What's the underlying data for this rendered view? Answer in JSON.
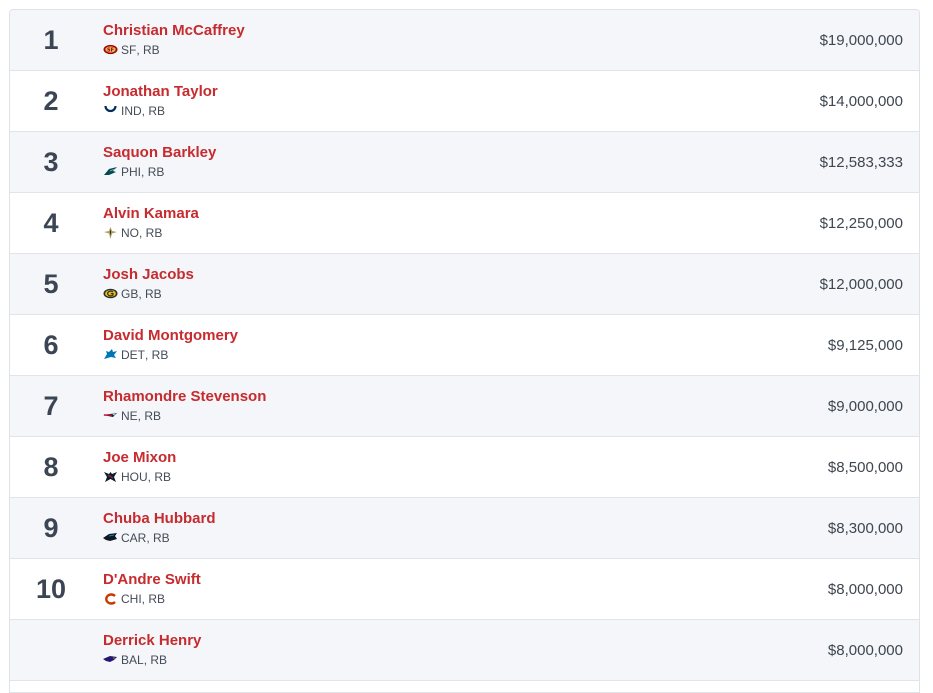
{
  "rows": [
    {
      "rank": "1",
      "name": "Christian McCaffrey",
      "team": "SF",
      "pos": "RB",
      "salary": "$19,000,000",
      "logo": "sf-49ers-logo-icon",
      "color": "#aa0000"
    },
    {
      "rank": "2",
      "name": "Jonathan Taylor",
      "team": "IND",
      "pos": "RB",
      "salary": "$14,000,000",
      "logo": "ind-colts-logo-icon",
      "color": "#002c5f"
    },
    {
      "rank": "3",
      "name": "Saquon Barkley",
      "team": "PHI",
      "pos": "RB",
      "salary": "$12,583,333",
      "logo": "phi-eagles-logo-icon",
      "color": "#004c54"
    },
    {
      "rank": "4",
      "name": "Alvin Kamara",
      "team": "NO",
      "pos": "RB",
      "salary": "$12,250,000",
      "logo": "no-saints-logo-icon",
      "color": "#b19a5b"
    },
    {
      "rank": "5",
      "name": "Josh Jacobs",
      "team": "GB",
      "pos": "RB",
      "salary": "$12,000,000",
      "logo": "gb-packers-logo-icon",
      "color": "#203731"
    },
    {
      "rank": "6",
      "name": "David Montgomery",
      "team": "DET",
      "pos": "RB",
      "salary": "$9,125,000",
      "logo": "det-lions-logo-icon",
      "color": "#0076b6"
    },
    {
      "rank": "7",
      "name": "Rhamondre Stevenson",
      "team": "NE",
      "pos": "RB",
      "salary": "$9,000,000",
      "logo": "ne-patriots-logo-icon",
      "color": "#002244"
    },
    {
      "rank": "8",
      "name": "Joe Mixon",
      "team": "HOU",
      "pos": "RB",
      "salary": "$8,500,000",
      "logo": "hou-texans-logo-icon",
      "color": "#03202f"
    },
    {
      "rank": "9",
      "name": "Chuba Hubbard",
      "team": "CAR",
      "pos": "RB",
      "salary": "$8,300,000",
      "logo": "car-panthers-logo-icon",
      "color": "#0085ca"
    },
    {
      "rank": "10",
      "name": "D'Andre Swift",
      "team": "CHI",
      "pos": "RB",
      "salary": "$8,000,000",
      "logo": "chi-bears-logo-icon",
      "color": "#c83803"
    },
    {
      "rank": "",
      "name": "Derrick Henry",
      "team": "BAL",
      "pos": "RB",
      "salary": "$8,000,000",
      "logo": "bal-ravens-logo-icon",
      "color": "#241773"
    }
  ]
}
